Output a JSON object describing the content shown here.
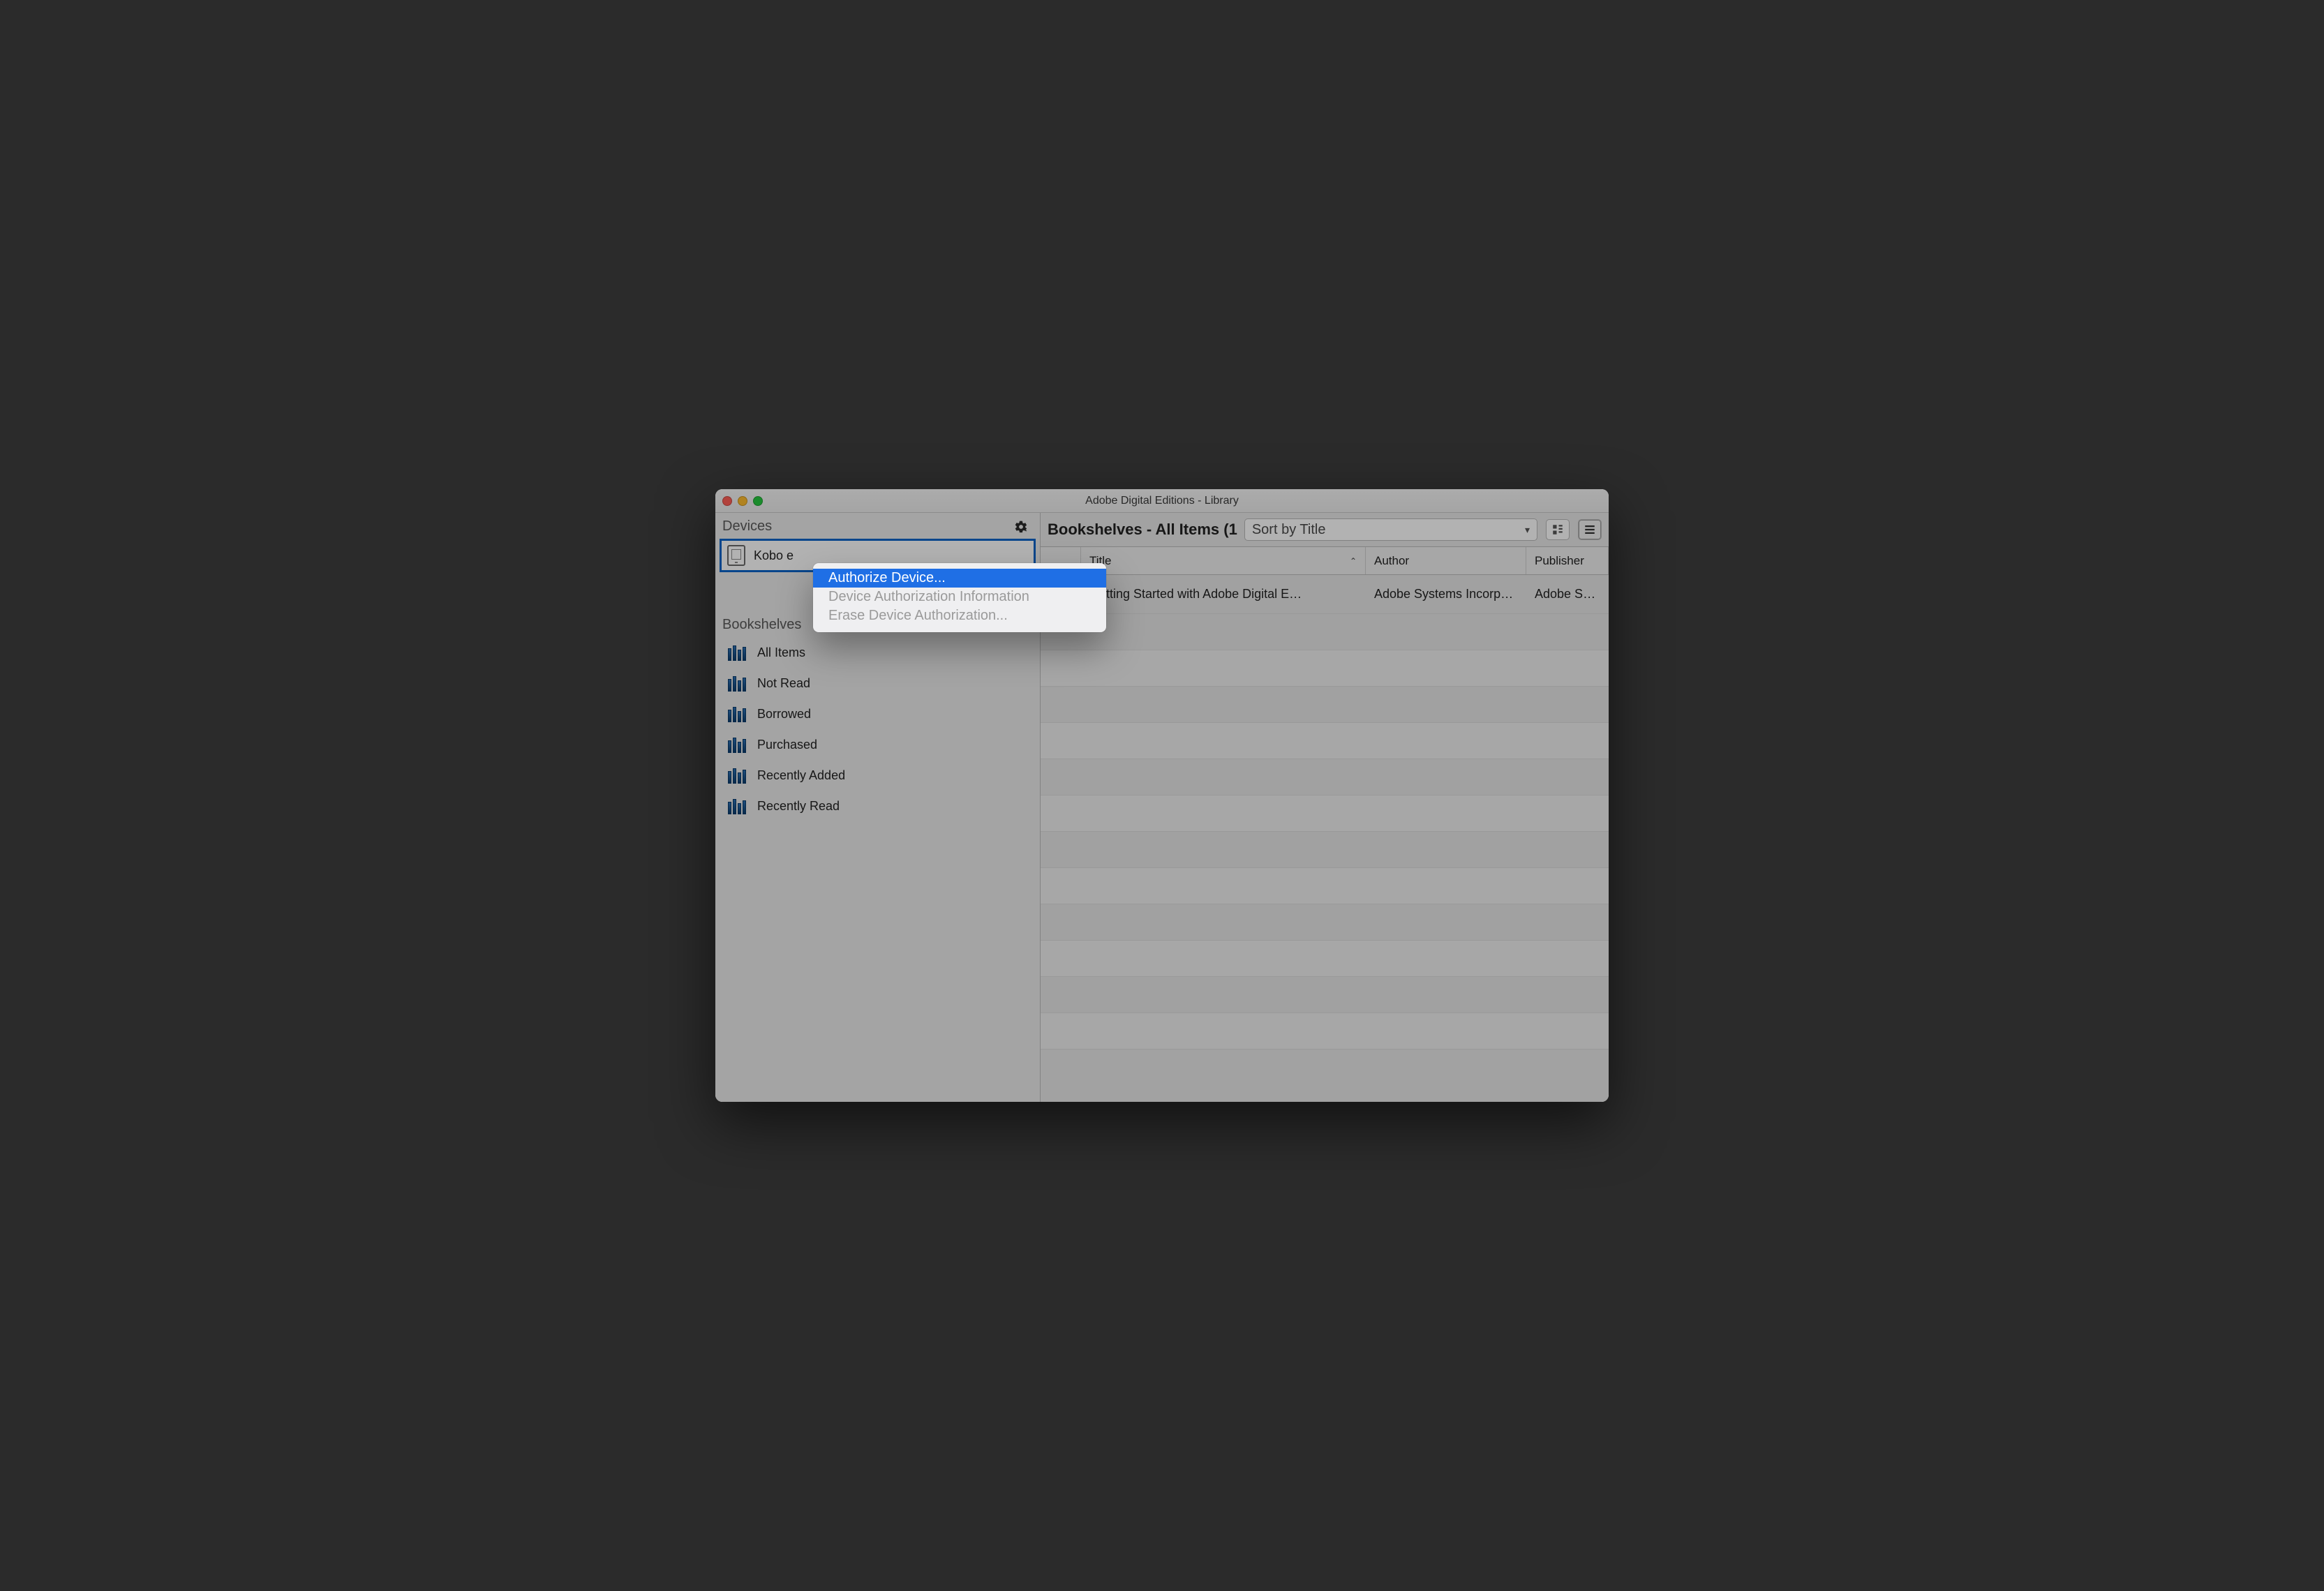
{
  "window": {
    "title": "Adobe Digital Editions - Library"
  },
  "sidebar": {
    "devices_header": "Devices",
    "bookshelves_header": "Bookshelves",
    "device_label": "Kobo e",
    "shelves": [
      {
        "label": "All Items"
      },
      {
        "label": "Not Read"
      },
      {
        "label": "Borrowed"
      },
      {
        "label": "Purchased"
      },
      {
        "label": "Recently Added"
      },
      {
        "label": "Recently Read"
      }
    ]
  },
  "toolbar": {
    "crumbs": "Bookshelves - All Items (1",
    "sort_label": "Sort by Title"
  },
  "columns": {
    "title": "Title",
    "author": "Author",
    "publisher": "Publisher"
  },
  "rows": [
    {
      "title": "Getting Started with Adobe Digital E…",
      "author": "Adobe Systems Incorp…",
      "publisher": "Adobe System"
    }
  ],
  "context_menu": {
    "items": [
      {
        "label": "Authorize Device...",
        "enabled": true,
        "highlight": true
      },
      {
        "label": "Device Authorization Information",
        "enabled": false,
        "highlight": false
      },
      {
        "label": "Erase Device Authorization...",
        "enabled": false,
        "highlight": false
      }
    ]
  }
}
